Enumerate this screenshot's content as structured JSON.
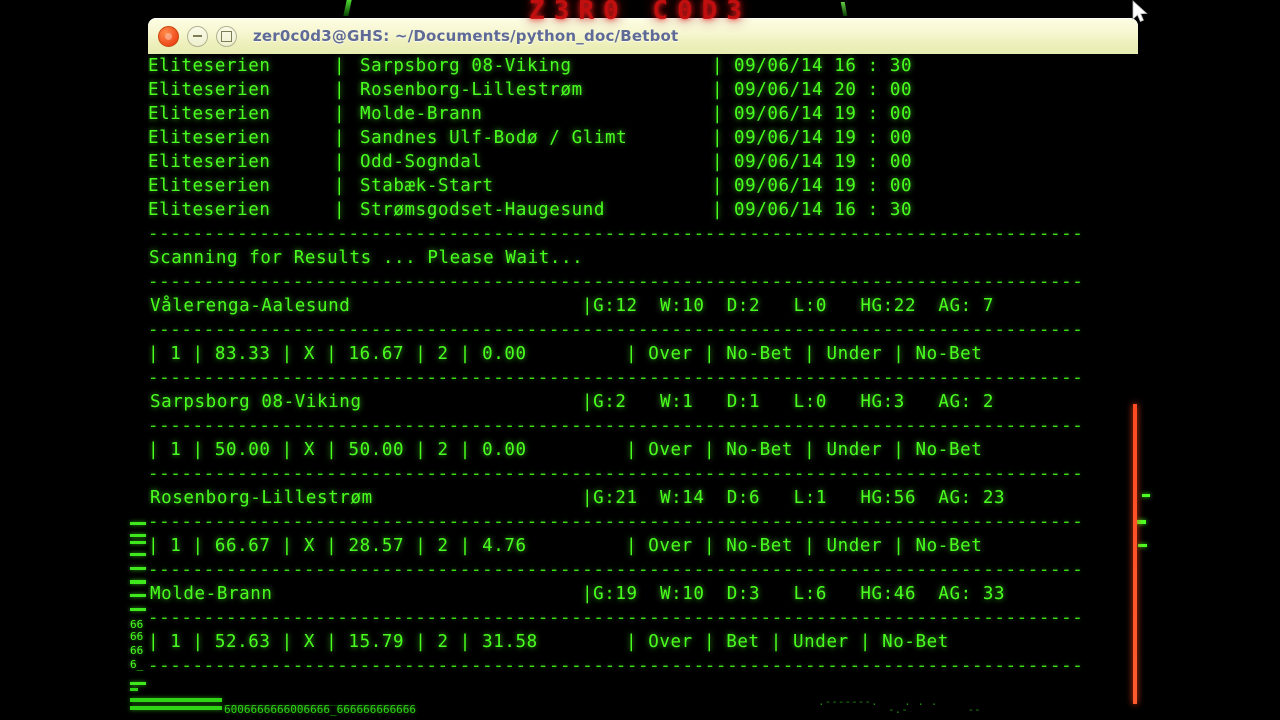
{
  "overlay": {
    "watermark": "Z3R0 C0D3",
    "watermark_color": "#cc1010"
  },
  "window": {
    "title": "zer0c0d3@GHS: ~/Documents/python_doc/Betbot",
    "buttons": {
      "close": "close",
      "minimize": "minimize",
      "maximize": "maximize"
    },
    "title_color": "#5f6a96",
    "titlebar_color": "#f3f4cb"
  },
  "terminal": {
    "foreground": "#3ee81c",
    "background": "#000000",
    "rule": "------------------------------------------------------------------------------------",
    "fixtures_header_bar": "|",
    "fixtures": [
      {
        "league": "Eliteserien",
        "sep": "|",
        "match": "Sarpsborg 08-Viking",
        "sep2": "|",
        "date": "09/06/14 16 : 30"
      },
      {
        "league": "Eliteserien",
        "sep": "|",
        "match": "Rosenborg-Lillestrøm",
        "sep2": "|",
        "date": "09/06/14 20 : 00"
      },
      {
        "league": "Eliteserien",
        "sep": "|",
        "match": "Molde-Brann",
        "sep2": "|",
        "date": "09/06/14 19 : 00"
      },
      {
        "league": "Eliteserien",
        "sep": "|",
        "match": "Sandnes Ulf-Bodø / Glimt",
        "sep2": "|",
        "date": "09/06/14 19 : 00"
      },
      {
        "league": "Eliteserien",
        "sep": "|",
        "match": "Odd-Sogndal",
        "sep2": "|",
        "date": "09/06/14 19 : 00"
      },
      {
        "league": "Eliteserien",
        "sep": "|",
        "match": "Stabæk-Start",
        "sep2": "|",
        "date": "09/06/14 19 : 00"
      },
      {
        "league": "Eliteserien",
        "sep": "|",
        "match": "Strømsgodset-Haugesund",
        "sep2": "|",
        "date": "09/06/14 16 : 30"
      }
    ],
    "status": "Scanning for Results ... Please Wait...",
    "results": [
      {
        "name": "Vålerenga-Aalesund",
        "stats": "|G:12  W:10  D:2   L:0   HG:22  AG: 7",
        "odds": "| 1 | 83.33 | X | 16.67 | 2 | 0.00",
        "bets": "| Over | No-Bet | Under | No-Bet"
      },
      {
        "name": "Sarpsborg 08-Viking",
        "stats": "|G:2   W:1   D:1   L:0   HG:3   AG: 2",
        "odds": "| 1 | 50.00 | X | 50.00 | 2 | 0.00",
        "bets": "| Over | No-Bet | Under | No-Bet"
      },
      {
        "name": "Rosenborg-Lillestrøm",
        "stats": "|G:21  W:14  D:6   L:1   HG:56  AG: 23",
        "odds": "| 1 | 66.67 | X | 28.57 | 2 | 4.76",
        "bets": "| Over | No-Bet | Under | No-Bet"
      },
      {
        "name": "Molde-Brann",
        "stats": "|G:19  W:10  D:3   L:6   HG:46  AG: 33",
        "odds": "| 1 | 52.63 | X | 15.79 | 2 | 31.58",
        "bets": "| Over | Bet | Under | No-Bet"
      }
    ]
  },
  "scrollbar": {
    "color": "#ff4a22"
  },
  "artifacts": {
    "bottom_noise_top": "____________________________",
    "bottom_noise_bottom": "6006666666006666_666666666666"
  }
}
